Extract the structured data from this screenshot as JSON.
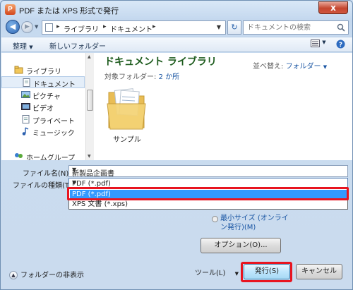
{
  "window": {
    "title": "PDF または XPS 形式で発行",
    "app_icon_letter": "P",
    "close": "x"
  },
  "address": {
    "crumbs": [
      "ライブラリ",
      "ドキュメント"
    ]
  },
  "search": {
    "placeholder": "ドキュメントの検索"
  },
  "toolbar": {
    "organize": "整理",
    "new_folder": "新しいフォルダー"
  },
  "nav": {
    "items": [
      {
        "label": "ライブラリ"
      },
      {
        "label": "ドキュメント",
        "selected": true
      },
      {
        "label": "ピクチャ"
      },
      {
        "label": "ビデオ"
      },
      {
        "label": "プライベート"
      },
      {
        "label": "ミュージック"
      },
      {
        "label": "ホームグループ"
      }
    ]
  },
  "library": {
    "title": "ドキュメント ライブラリ",
    "target_label": "対象フォルダー:",
    "target_value": "2 か所",
    "arrange_label": "並べ替え:",
    "arrange_value": "フォルダー"
  },
  "files": [
    {
      "name": "サンプル"
    }
  ],
  "form": {
    "filename_label": "ファイル名(N):",
    "filename_value": "新製品企画書",
    "filetype_label": "ファイルの種類(T):",
    "filetype_value": "PDF (*.pdf)",
    "filetype_options": [
      "PDF (*.pdf)",
      "XPS 文書 (*.xps)"
    ]
  },
  "options": {
    "min_size_label": "最小サイズ (オンライン発行)(M)",
    "options_button": "オプション(O)..."
  },
  "footer": {
    "hide_folders": "フォルダーの非表示",
    "tools": "ツール(L)",
    "publish": "発行(S)",
    "cancel": "キャンセル"
  },
  "colors": {
    "highlight": "#e8141f",
    "selection": "#3399ff",
    "library_title": "#1e5c1e",
    "link": "#1b56a3"
  }
}
